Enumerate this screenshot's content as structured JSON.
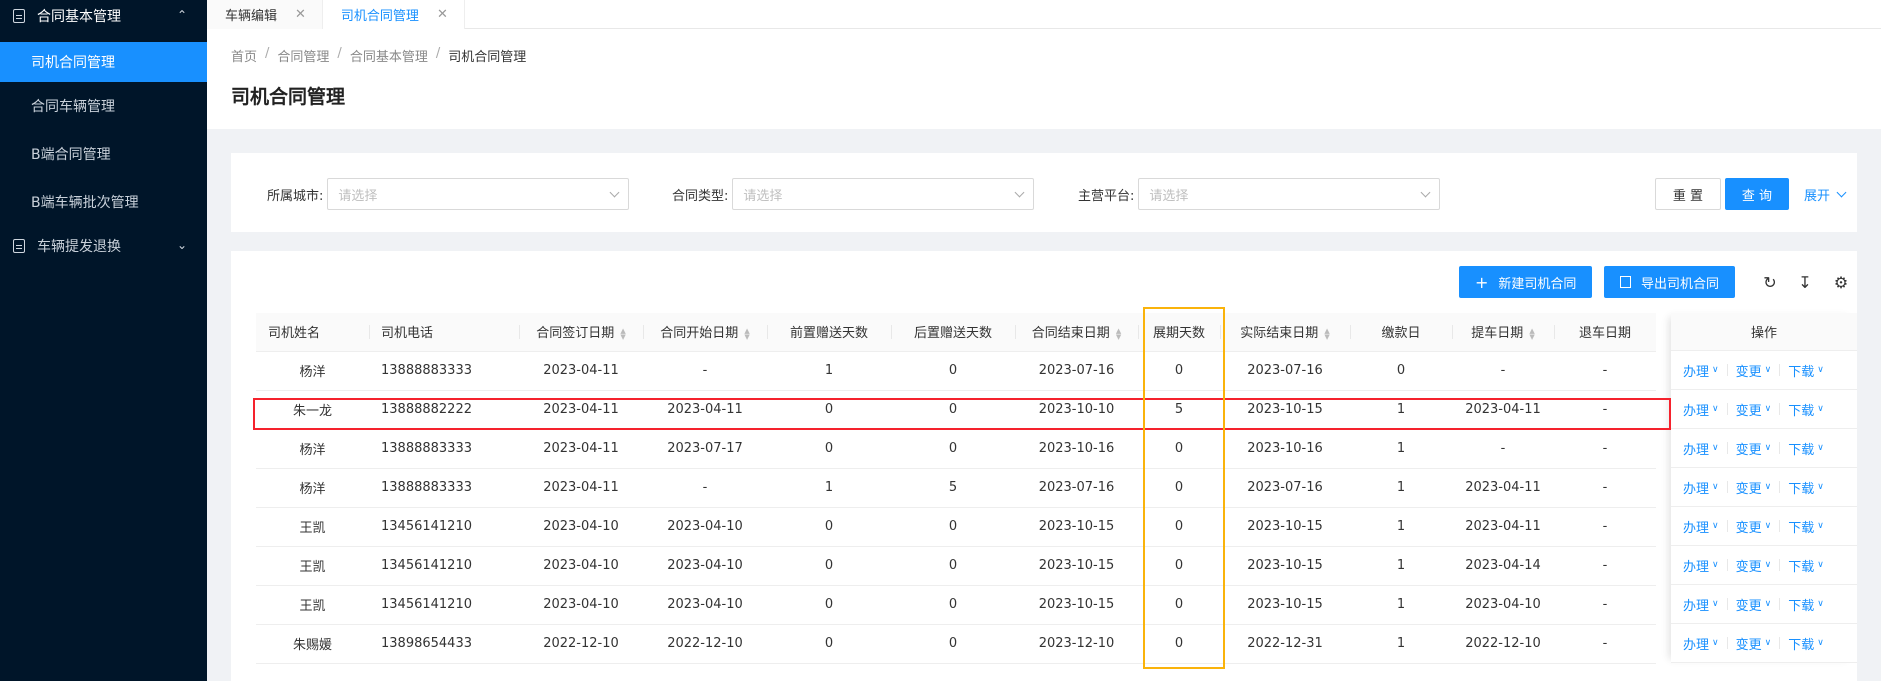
{
  "sidebar": {
    "group1": "合同基本管理",
    "items": [
      "司机合同管理",
      "合同车辆管理",
      "B端合同管理",
      "B端车辆批次管理"
    ],
    "group2": "车辆提发退换"
  },
  "tabs": [
    {
      "label": "车辆编辑"
    },
    {
      "label": "司机合同管理"
    }
  ],
  "breadcrumb": [
    "首页",
    "合同管理",
    "合同基本管理",
    "司机合同管理"
  ],
  "page_title": "司机合同管理",
  "filters": {
    "city_label": "所属城市:",
    "city_placeholder": "请选择",
    "type_label": "合同类型:",
    "type_placeholder": "请选择",
    "platform_label": "主营平台:",
    "platform_placeholder": "请选择",
    "reset": "重 置",
    "query": "查 询",
    "expand": "展开"
  },
  "toolbar": {
    "new": "新建司机合同",
    "export": "导出司机合同"
  },
  "table": {
    "columns": [
      "司机姓名",
      "司机电话",
      "合同签订日期",
      "合同开始日期",
      "前置赠送天数",
      "后置赠送天数",
      "合同结束日期",
      "展期天数",
      "实际结束日期",
      "缴款日",
      "提车日期",
      "退车日期"
    ],
    "ops_header": "操作",
    "ops": [
      "办理",
      "变更",
      "下载"
    ],
    "rows": [
      [
        "杨洋",
        "13888883333",
        "2023-04-11",
        "-",
        "1",
        "0",
        "2023-07-16",
        "0",
        "2023-07-16",
        "0",
        "-",
        "-"
      ],
      [
        "朱一龙",
        "13888882222",
        "2023-04-11",
        "2023-04-11",
        "0",
        "0",
        "2023-10-10",
        "5",
        "2023-10-15",
        "1",
        "2023-04-11",
        "-"
      ],
      [
        "杨洋",
        "13888883333",
        "2023-04-11",
        "2023-07-17",
        "0",
        "0",
        "2023-10-16",
        "0",
        "2023-10-16",
        "1",
        "-",
        "-"
      ],
      [
        "杨洋",
        "13888883333",
        "2023-04-11",
        "-",
        "1",
        "5",
        "2023-07-16",
        "0",
        "2023-07-16",
        "1",
        "2023-04-11",
        "-"
      ],
      [
        "王凯",
        "13456141210",
        "2023-04-10",
        "2023-04-10",
        "0",
        "0",
        "2023-10-15",
        "0",
        "2023-10-15",
        "1",
        "2023-04-11",
        "-"
      ],
      [
        "王凯",
        "13456141210",
        "2023-04-10",
        "2023-04-10",
        "0",
        "0",
        "2023-10-15",
        "0",
        "2023-10-15",
        "1",
        "2023-04-14",
        "-"
      ],
      [
        "王凯",
        "13456141210",
        "2023-04-10",
        "2023-04-10",
        "0",
        "0",
        "2023-10-15",
        "0",
        "2023-10-15",
        "1",
        "2023-04-10",
        "-"
      ],
      [
        "朱赐媛",
        "13898654433",
        "2022-12-10",
        "2022-12-10",
        "0",
        "0",
        "2023-12-10",
        "0",
        "2022-12-31",
        "1",
        "2022-12-10",
        "-"
      ]
    ]
  }
}
